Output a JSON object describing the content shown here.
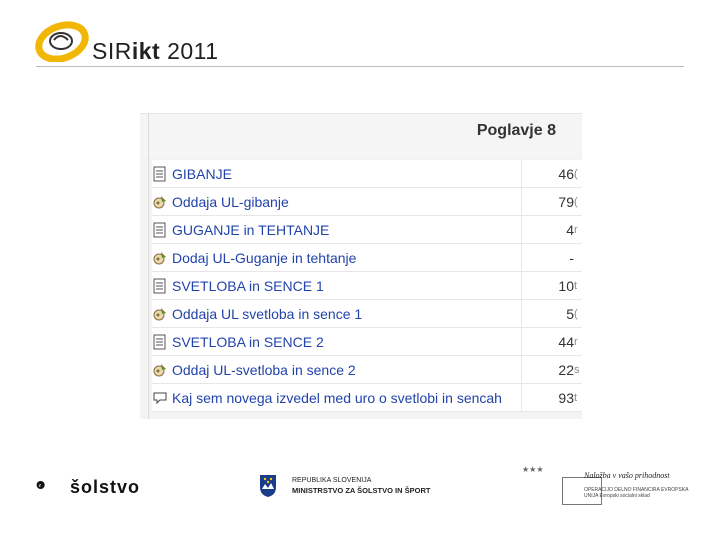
{
  "header": {
    "logo_prefix": "SIR",
    "logo_bold": "ikt",
    "logo_year": " 2011"
  },
  "screenshot": {
    "chapter_title": "Poglavje 8",
    "rows": [
      {
        "icon": "document-icon",
        "label": "GIBANJE",
        "value": "46",
        "trail": "("
      },
      {
        "icon": "assignment-icon",
        "label": "Oddaja UL-gibanje",
        "value": "79",
        "trail": "("
      },
      {
        "icon": "document-icon",
        "label": "GUGANJE in TEHTANJE",
        "value": "4",
        "trail": "r"
      },
      {
        "icon": "assignment-icon",
        "label": "Dodaj UL-Guganje in tehtanje",
        "value": "-",
        "trail": ""
      },
      {
        "icon": "document-icon",
        "label": "SVETLOBA in SENCE 1",
        "value": "10",
        "trail": "t"
      },
      {
        "icon": "assignment-icon",
        "label": "Oddaja UL svetloba in sence 1",
        "value": "5",
        "trail": "("
      },
      {
        "icon": "document-icon",
        "label": "SVETLOBA in SENCE 2",
        "value": "44",
        "trail": "r"
      },
      {
        "icon": "assignment-icon",
        "label": "Oddaj UL-svetloba in sence 2",
        "value": "22",
        "trail": "s"
      },
      {
        "icon": "forum-icon",
        "label": "Kaj sem novega izvedel med uro o svetlobi in sencah",
        "value": "93",
        "trail": "t"
      }
    ]
  },
  "footer": {
    "esolstvo": "šolstvo",
    "republika_line1": "REPUBLIKA SLOVENIJA",
    "republika_line2": "MINISTRSTVO ZA ŠOLSTVO IN ŠPORT",
    "eu_slogan": "Naložba v vašo prihodnost",
    "eu_sub": "OPERACIJO DELNO FINANCIRA EVROPSKA UNIJA Evropski socialni sklad"
  },
  "colors": {
    "link": "#2244aa",
    "logo_yellow": "#f2b705"
  }
}
